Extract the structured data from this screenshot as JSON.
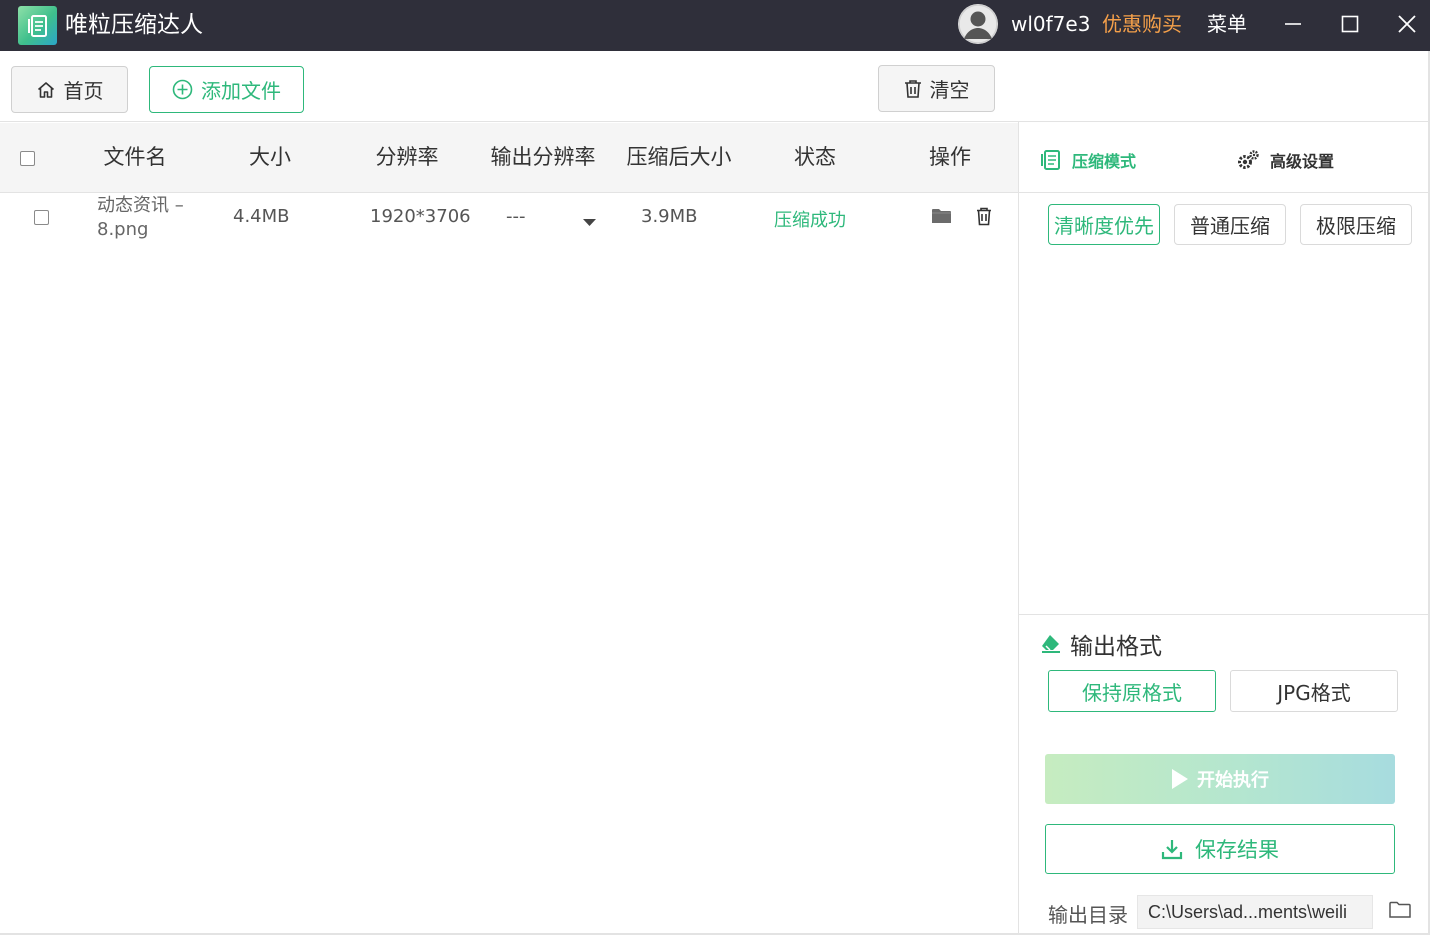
{
  "titlebar": {
    "app_name": "唯粒压缩达人",
    "username": "wl0f7e3",
    "promo": "优惠购买",
    "menu": "菜单"
  },
  "toolbar": {
    "home_label": "首页",
    "add_label": "添加文件",
    "clear_label": "清空"
  },
  "table": {
    "headers": [
      "文件名",
      "大小",
      "分辨率",
      "输出分辨率",
      "压缩后大小",
      "状态",
      "操作"
    ],
    "rows": [
      {
        "filename_line1": "动态资讯 –",
        "filename_line2": "8.png",
        "size": "4.4MB",
        "resolution": "1920*3706",
        "output_resolution": "---",
        "compressed_size": "3.9MB",
        "status": "压缩成功"
      }
    ]
  },
  "right_panel": {
    "tabs": {
      "mode": "压缩模式",
      "advanced": "高级设置"
    },
    "modes": [
      "清晰度优先",
      "普通压缩",
      "极限压缩"
    ],
    "selected_mode": "清晰度优先",
    "format_title": "输出格式",
    "formats": [
      "保持原格式",
      "JPG格式"
    ],
    "selected_format": "保持原格式",
    "start_label": "开始执行",
    "save_label": "保存结果",
    "output_dir_label": "输出目录",
    "output_dir_value": "C:\\Users\\ad...ments\\weili"
  },
  "colors": {
    "accent": "#2eb87b",
    "titlebar_bg": "#2f2f3a",
    "promo": "#f5a04a"
  }
}
